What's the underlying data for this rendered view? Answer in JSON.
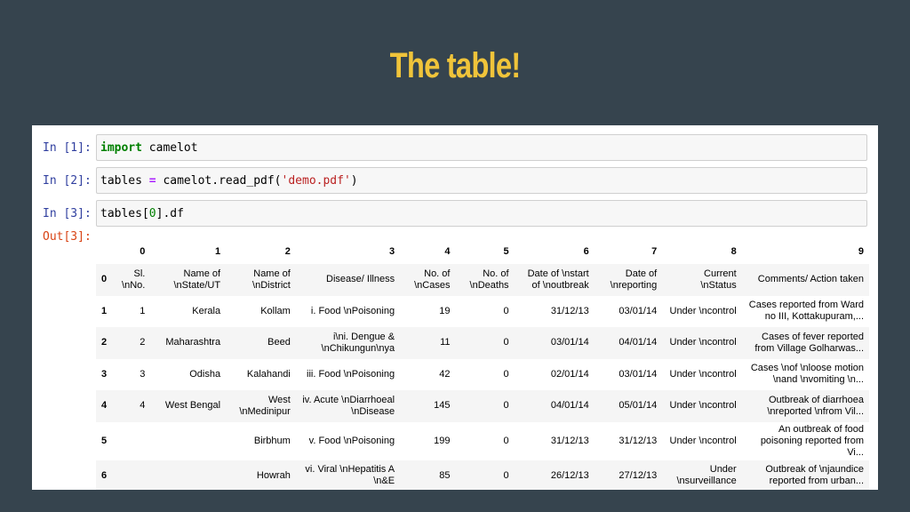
{
  "slide": {
    "title": "The table!"
  },
  "cells": [
    {
      "prompt": "In [1]:",
      "tokens": [
        {
          "t": "import",
          "c": "kw"
        },
        {
          "t": " camelot",
          "c": ""
        }
      ]
    },
    {
      "prompt": "In [2]:",
      "tokens": [
        {
          "t": "tables ",
          "c": ""
        },
        {
          "t": "=",
          "c": "op"
        },
        {
          "t": " camelot.read_pdf(",
          "c": ""
        },
        {
          "t": "'demo.pdf'",
          "c": "str"
        },
        {
          "t": ")",
          "c": ""
        }
      ]
    },
    {
      "prompt": "In [3]:",
      "tokens": [
        {
          "t": "tables[",
          "c": ""
        },
        {
          "t": "0",
          "c": "num"
        },
        {
          "t": "].df",
          "c": ""
        }
      ]
    }
  ],
  "output": {
    "prompt": "Out[3]:",
    "columns": [
      "",
      "0",
      "1",
      "2",
      "3",
      "4",
      "5",
      "6",
      "7",
      "8",
      "9"
    ],
    "rows": [
      [
        "0",
        "Sl. \\nNo.",
        "Name of \\nState/UT",
        "Name of \\nDistrict",
        "Disease/ Illness",
        "No. of \\nCases",
        "No. of \\nDeaths",
        "Date of \\nstart of \\noutbreak",
        "Date of \\nreporting",
        "Current \\nStatus",
        "Comments/ Action taken"
      ],
      [
        "1",
        "1",
        "Kerala",
        "Kollam",
        "i. Food \\nPoisoning",
        "19",
        "0",
        "31/12/13",
        "03/01/14",
        "Under \\ncontrol",
        "Cases reported from Ward no III, Kottakupuram,..."
      ],
      [
        "2",
        "2",
        "Maharashtra",
        "Beed",
        "i\\ni. Dengue & \\nChikungun\\nya",
        "11",
        "0",
        "03/01/14",
        "04/01/14",
        "Under \\ncontrol",
        "Cases of fever reported from Village Golharwas..."
      ],
      [
        "3",
        "3",
        "Odisha",
        "Kalahandi",
        "iii. Food \\nPoisoning",
        "42",
        "0",
        "02/01/14",
        "03/01/14",
        "Under \\ncontrol",
        "Cases \\nof \\nloose motion \\nand \\nvomiting \\n..."
      ],
      [
        "4",
        "4",
        "West Bengal",
        "West \\nMedinipur",
        "iv. Acute \\nDiarrhoeal \\nDisease",
        "145",
        "0",
        "04/01/14",
        "05/01/14",
        "Under \\ncontrol",
        "Outbreak of diarrhoea \\nreported \\nfrom Vil..."
      ],
      [
        "5",
        "",
        "",
        "Birbhum",
        "v. Food \\nPoisoning",
        "199",
        "0",
        "31/12/13",
        "31/12/13",
        "Under \\ncontrol",
        "An outbreak of food poisoning reported from Vi..."
      ],
      [
        "6",
        "",
        "",
        "Howrah",
        "vi. Viral \\nHepatitis A \\n&E",
        "85",
        "0",
        "26/12/13",
        "27/12/13",
        "Under \\nsurveillance",
        "Outbreak of \\njaundice reported from urban..."
      ]
    ]
  },
  "colors": {
    "background": "#36444e",
    "title": "#f0c43a",
    "prompt_in": "#303f9f",
    "prompt_out": "#d84315"
  }
}
